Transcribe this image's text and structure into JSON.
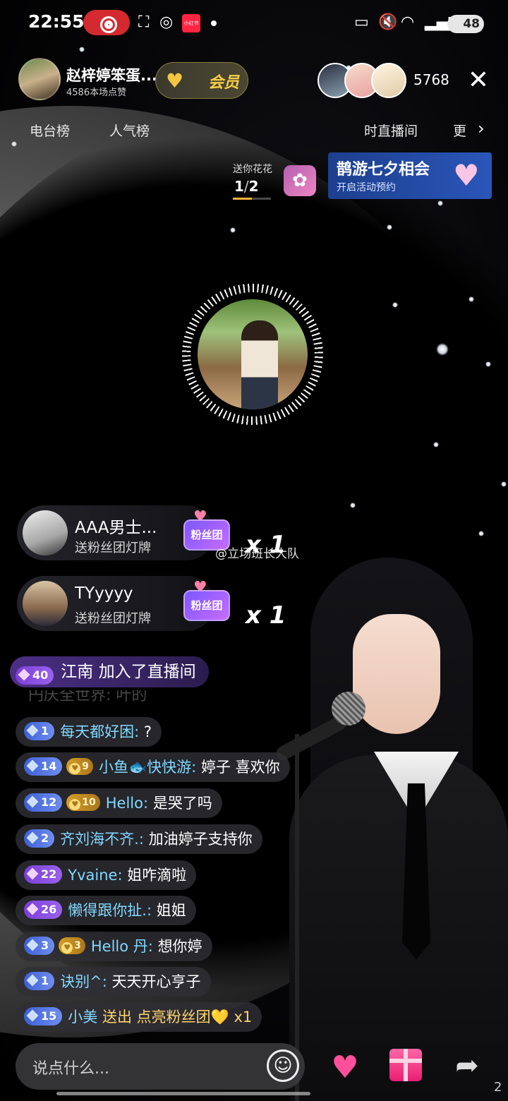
{
  "status_bar": {
    "time": "22:55",
    "xhs_label": "小红书",
    "battery": "48",
    "icons": [
      "record-icon",
      "scan-icon",
      "weibo-icon",
      "cast-icon",
      "mute-icon",
      "wifi-icon",
      "signal-icon"
    ]
  },
  "host": {
    "name": "赵梓婷笨蛋...",
    "likes": "4586本场点赞",
    "vip_label": "会员"
  },
  "viewers": {
    "count": "5768"
  },
  "rank_tabs": [
    "电台榜",
    "人气榜",
    "时直播间",
    "更"
  ],
  "task": {
    "label": "送你花花",
    "done": "1",
    "total": "2",
    "progress": 0.5
  },
  "event": {
    "title": "鹊游七夕相会",
    "subtitle": "开启活动预约"
  },
  "gift_cards": [
    {
      "name": "AAA男士...",
      "desc": "送粉丝团灯牌",
      "badge": "粉丝团",
      "mult": "x 1"
    },
    {
      "name": "TYyyyy",
      "desc": "送粉丝团灯牌",
      "badge": "粉丝团",
      "mult": "x 1"
    }
  ],
  "watermark": "@立场班长大队",
  "join": {
    "level": "40",
    "text": "江南 加入了直播间"
  },
  "faded_text": "円庆全世界: 叶的",
  "chat": [
    {
      "level": "1",
      "name": "每天都好困:",
      "msg": "?"
    },
    {
      "level": "14",
      "fan": "9",
      "name": "小鱼🐟快快游:",
      "msg": "婷子 喜欢你"
    },
    {
      "level": "12",
      "fan": "10",
      "name": "Hello:",
      "msg": "是哭了吗"
    },
    {
      "level": "2",
      "name": "齐刘海不齐.:",
      "msg": "加油婷子支持你"
    },
    {
      "level": "22",
      "name": "Yvaine:",
      "msg": "姐咋滴啦"
    },
    {
      "level": "26",
      "name": "懒得跟你扯.:",
      "msg": "姐姐"
    },
    {
      "level": "3",
      "fan": "3",
      "name": "Hello 丹:",
      "msg": "想你婷"
    },
    {
      "level": "1",
      "name": "诀别^:",
      "msg": "天天开心亨子"
    },
    {
      "level": "15",
      "name": "小美",
      "msg": "送出 点亮粉丝团💛 x1"
    }
  ],
  "input": {
    "placeholder": "说点什么..."
  },
  "corner": "2"
}
